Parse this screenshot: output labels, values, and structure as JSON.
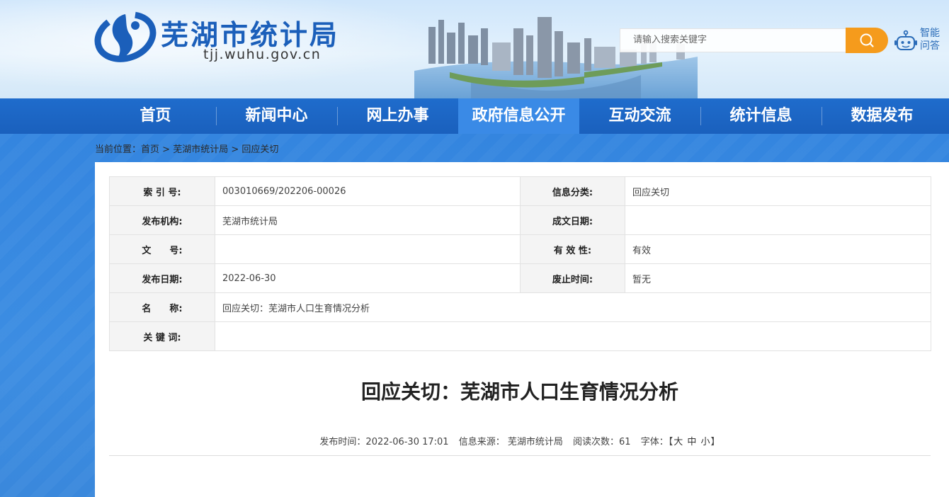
{
  "header": {
    "site_name": "芜湖市统计局",
    "domain": "tjj.wuhu.gov.cn",
    "search_placeholder": "请输入搜索关键字",
    "assistant_label": "智能问答",
    "brand_color": "#1b5fba",
    "accent_color": "#f59b1c"
  },
  "nav": {
    "items": [
      {
        "label": "首页"
      },
      {
        "label": "新闻中心"
      },
      {
        "label": "网上办事"
      },
      {
        "label": "政府信息公开",
        "active": true
      },
      {
        "label": "互动交流"
      },
      {
        "label": "统计信息"
      },
      {
        "label": "数据发布"
      }
    ]
  },
  "breadcrumb": {
    "prefix": "当前位置：",
    "items": [
      "首页",
      "芜湖市统计局",
      "回应关切"
    ],
    "separator": " > "
  },
  "meta": {
    "index_label": "索 引 号:",
    "index_value": "003010669/202206-00026",
    "category_label": "信息分类:",
    "category_value": "回应关切",
    "publisher_label": "发布机构:",
    "publisher_value": "芜湖市统计局",
    "created_label": "成文日期:",
    "created_value": "",
    "docno_label": "文　　号:",
    "docno_value": "",
    "validity_label": "有 效 性:",
    "validity_value": "有效",
    "pubdate_label": "发布日期:",
    "pubdate_value": "2022-06-30",
    "abolish_label": "废止时间:",
    "abolish_value": "暂无",
    "name_label": "名　　称:",
    "name_value": "回应关切：芜湖市人口生育情况分析",
    "keywords_label": "关 键 词:",
    "keywords_value": ""
  },
  "article": {
    "title": "回应关切：芜湖市人口生育情况分析",
    "pub_time": "发布时间：2022-06-30 17:01",
    "source": "信息来源： 芜湖市统计局",
    "views": "阅读次数：61",
    "font_label": "字体：",
    "font_open": "【",
    "font_large": "大",
    "font_medium": "中",
    "font_small": "小",
    "font_close": "】"
  }
}
